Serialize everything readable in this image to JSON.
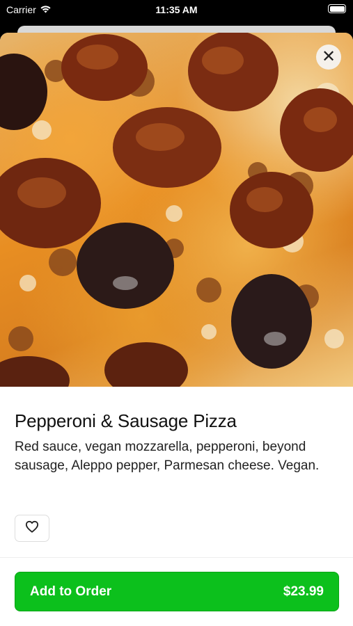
{
  "status_bar": {
    "carrier": "Carrier",
    "time": "11:35 AM"
  },
  "icons": {
    "wifi": "wifi-icon",
    "battery": "battery-icon",
    "close": "close-icon",
    "heart": "heart-icon"
  },
  "product": {
    "image_alt": "Close-up of pepperoni and sausage pizza",
    "title": "Pepperoni & Sausage Pizza",
    "description": "Red sauce, vegan mozzarella, pepperoni, beyond sausage, Aleppo pepper, Parmesan cheese. Vegan."
  },
  "close_button": {
    "label": "✕"
  },
  "order_button": {
    "label": "Add to Order",
    "price": "$23.99"
  },
  "colors": {
    "accent": "#0cc01c",
    "status_bar_bg": "#000000",
    "sheet_bg": "#ffffff"
  }
}
